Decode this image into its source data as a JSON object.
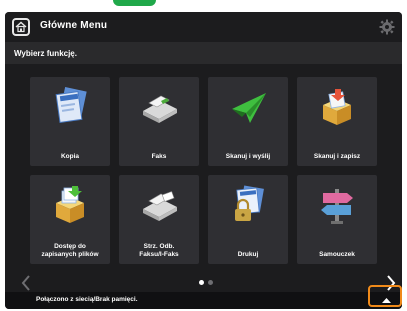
{
  "header": {
    "title": "Główne Menu"
  },
  "subheader": {
    "text": "Wybierz funkcję."
  },
  "tiles": [
    {
      "label": "Kopia",
      "icon": "copy-icon"
    },
    {
      "label": "Faks",
      "icon": "fax-icon"
    },
    {
      "label": "Skanuj i wyślij",
      "icon": "scan-send-icon"
    },
    {
      "label": "Skanuj i zapisz",
      "icon": "scan-store-icon"
    },
    {
      "label": "Dostęp do\nzapisanych plików",
      "icon": "stored-files-icon"
    },
    {
      "label": "Strz. Odb.\nFaksu/I-Faks",
      "icon": "fax-inbox-icon"
    },
    {
      "label": "Drukuj",
      "icon": "print-icon"
    },
    {
      "label": "Samouczek",
      "icon": "signpost-icon"
    }
  ],
  "pager": {
    "current": 1,
    "total": 2
  },
  "status": {
    "text": "Połączono z siecią/Brak pamięci."
  },
  "colors": {
    "accent_highlight": "#f08a1a",
    "tab_green": "#20a84a"
  }
}
